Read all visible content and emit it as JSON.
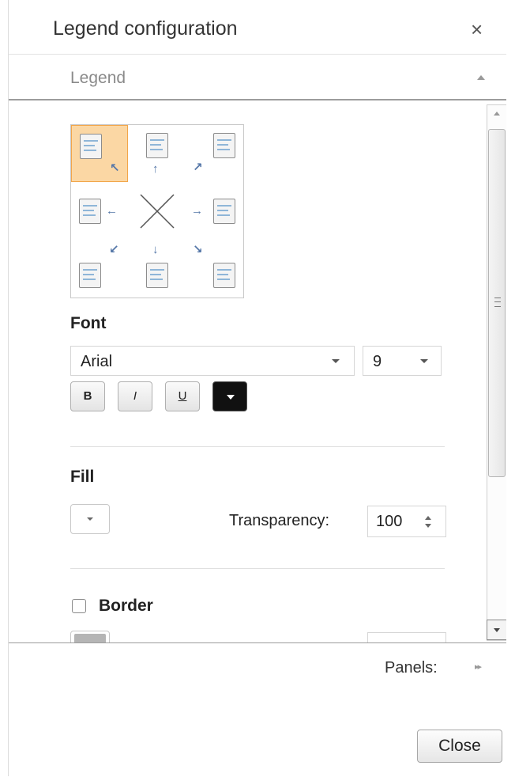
{
  "dialog": {
    "title": "Legend configuration",
    "close_glyph": "×",
    "close_button_label": "Close"
  },
  "section": {
    "title": "Legend",
    "collapse_icon": "caret-up-icon"
  },
  "position": {
    "selected": "top-left",
    "cells": [
      "top-left",
      "top",
      "top-right",
      "left",
      "none",
      "right",
      "bottom-left",
      "bottom",
      "bottom-right"
    ],
    "arrow_color": "#5577a8",
    "selected_fill": "#fbd7a4"
  },
  "font": {
    "heading": "Font",
    "family": "Arial",
    "size": "9",
    "bold_label": "B",
    "italic_label": "I",
    "underline_label": "U",
    "color": "#000000"
  },
  "fill": {
    "heading": "Fill",
    "transparency_label": "Transparency:",
    "transparency_value": "100"
  },
  "border": {
    "label": "Border",
    "checked": false
  },
  "footer": {
    "panels_label": "Panels:",
    "panels_arrow": "▸▸"
  }
}
